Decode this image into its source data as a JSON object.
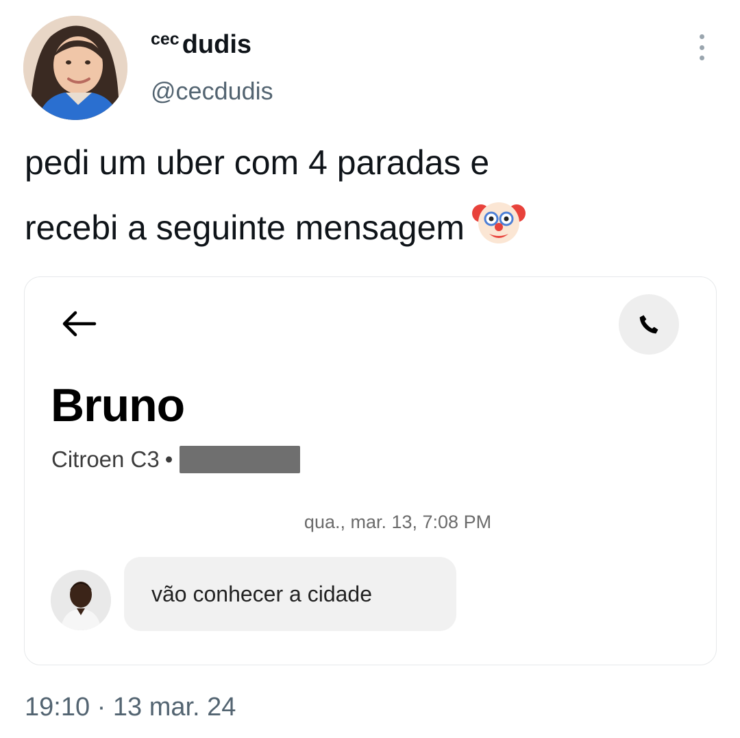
{
  "tweet": {
    "author": {
      "name_prefix": "cec",
      "name": "dudis",
      "handle": "@cecdudis"
    },
    "text_line1": "pedi um uber com 4 paradas e",
    "text_line2": "recebi a seguinte mensagem",
    "emoji_icon": "clown-face-icon",
    "time": "19:10",
    "separator": "·",
    "date": "13 mar. 24"
  },
  "screenshot": {
    "driver_name": "Bruno",
    "vehicle": "Citroen C3",
    "vehicle_separator": "•",
    "chat_timestamp": "qua., mar. 13, 7:08 PM",
    "message": "vão conhecer a cidade",
    "icons": [
      "back-arrow-icon",
      "phone-icon"
    ]
  },
  "colors": {
    "text_primary": "#0f1419",
    "text_secondary": "#536471",
    "card_border": "#e6e8ea",
    "bubble_bg": "#f1f1f1",
    "call_button_bg": "#eeeeee"
  }
}
